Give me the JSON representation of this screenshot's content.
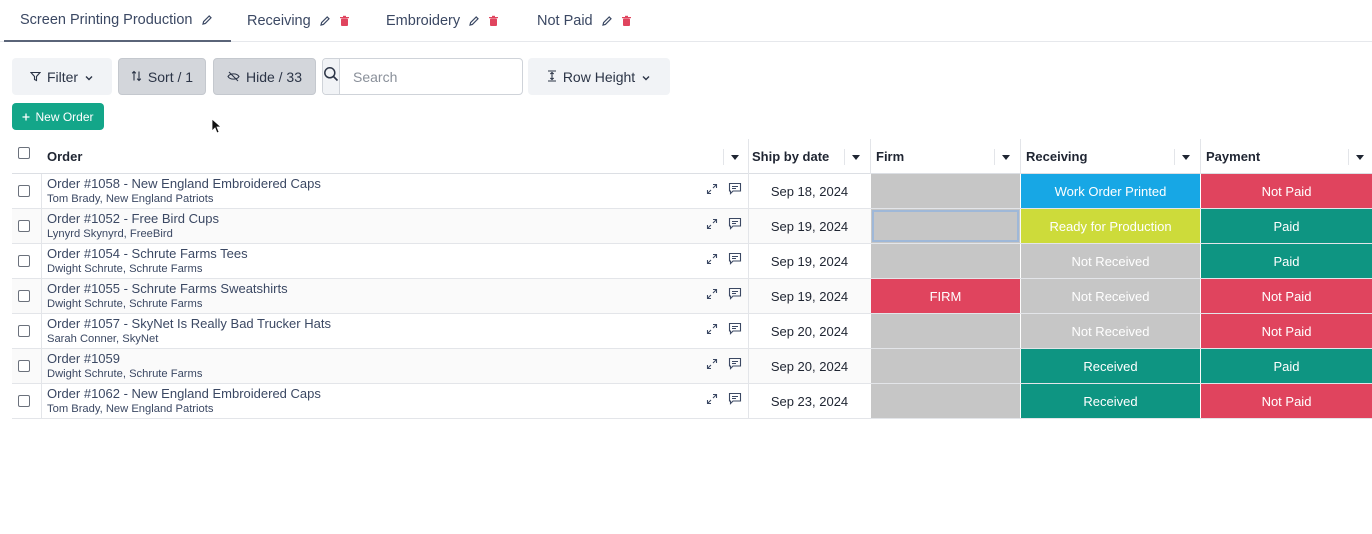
{
  "tabs": [
    {
      "label": "Screen Printing Production",
      "active": true,
      "deletable": false
    },
    {
      "label": "Receiving",
      "active": false,
      "deletable": true
    },
    {
      "label": "Embroidery",
      "active": false,
      "deletable": true
    },
    {
      "label": "Not Paid",
      "active": false,
      "deletable": true
    }
  ],
  "toolbar": {
    "filter_label": "Filter",
    "sort_label": "Sort / 1",
    "hide_label": "Hide / 33",
    "search_placeholder": "Search",
    "search_value": "",
    "row_height_label": "Row Height"
  },
  "new_order_label": "New Order",
  "columns": {
    "order": "Order",
    "ship": "Ship by date",
    "firm": "Firm",
    "receiving": "Receiving",
    "payment": "Payment"
  },
  "colors": {
    "accent": "#13a689",
    "teal": "#0e9582",
    "red": "#e0445e",
    "grey": "#c6c6c6",
    "blue": "#17a7e5",
    "lime": "#cddb3a"
  },
  "rows": [
    {
      "title": "Order #1058 - New England Embroidered Caps",
      "sub": "Tom Brady, New England Patriots",
      "ship": "Sep 18, 2024",
      "firm": "",
      "firm_color": "#c6c6c6",
      "receiving": "Work Order Printed",
      "receiving_color": "#17a7e5",
      "payment": "Not Paid",
      "payment_color": "#e0445e"
    },
    {
      "title": "Order #1052 - Free Bird Cups",
      "sub": "Lynyrd Skynyrd, FreeBird",
      "ship": "Sep 19, 2024",
      "firm": "",
      "firm_color": "#c6c6c6",
      "receiving": "Ready for Production",
      "receiving_color": "#cddb3a",
      "payment": "Paid",
      "payment_color": "#0e9582"
    },
    {
      "title": "Order #1054 - Schrute Farms Tees",
      "sub": "Dwight Schrute, Schrute Farms",
      "ship": "Sep 19, 2024",
      "firm": "",
      "firm_color": "#c6c6c6",
      "receiving": "Not Received",
      "receiving_color": "#c6c6c6",
      "payment": "Paid",
      "payment_color": "#0e9582"
    },
    {
      "title": "Order #1055 - Schrute Farms Sweatshirts",
      "sub": "Dwight Schrute, Schrute Farms",
      "ship": "Sep 19, 2024",
      "firm": "FIRM",
      "firm_color": "#e0445e",
      "receiving": "Not Received",
      "receiving_color": "#c6c6c6",
      "payment": "Not Paid",
      "payment_color": "#e0445e"
    },
    {
      "title": "Order #1057 - SkyNet Is Really Bad Trucker Hats",
      "sub": "Sarah Conner, SkyNet",
      "ship": "Sep 20, 2024",
      "firm": "",
      "firm_color": "#c6c6c6",
      "receiving": "Not Received",
      "receiving_color": "#c6c6c6",
      "payment": "Not Paid",
      "payment_color": "#e0445e"
    },
    {
      "title": "Order #1059",
      "sub": "Dwight Schrute, Schrute Farms",
      "ship": "Sep 20, 2024",
      "firm": "",
      "firm_color": "#c6c6c6",
      "receiving": "Received",
      "receiving_color": "#0e9582",
      "payment": "Paid",
      "payment_color": "#0e9582"
    },
    {
      "title": "Order #1062 - New England Embroidered Caps",
      "sub": "Tom Brady, New England Patriots",
      "ship": "Sep 23, 2024",
      "firm": "",
      "firm_color": "#c6c6c6",
      "receiving": "Received",
      "receiving_color": "#0e9582",
      "payment": "Not Paid",
      "payment_color": "#e0445e"
    }
  ]
}
